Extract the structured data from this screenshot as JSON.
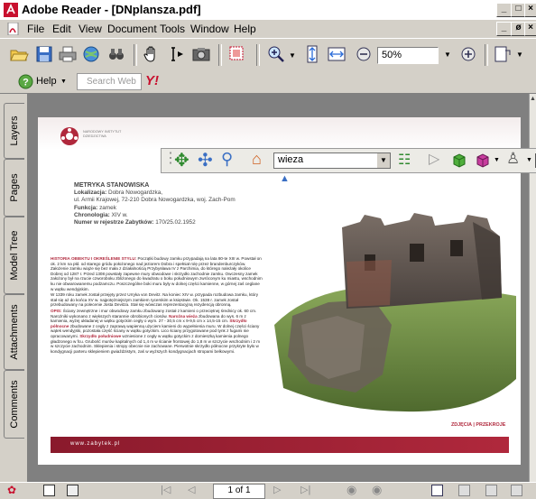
{
  "window": {
    "title": "Adobe Reader - [DNplansza.pdf]",
    "controls": [
      "_",
      "□",
      "×"
    ],
    "doc_controls": [
      "_",
      "ø",
      "×"
    ]
  },
  "menu": {
    "items": [
      "File",
      "Edit",
      "View",
      "Document",
      "Tools",
      "Window",
      "Help"
    ]
  },
  "toolbar": {
    "zoom_value": "50%",
    "search_placeholder": "Search Web",
    "help_label": "Help"
  },
  "model_toolbar": {
    "view_value": "wieza"
  },
  "side_tabs": [
    "Layers",
    "Pages",
    "Model Tree",
    "Attachments",
    "Comments"
  ],
  "document": {
    "heading": "METRYKA STANOWISKA",
    "lines": [
      {
        "label": "Lokalizacja:",
        "value": "Dobra Nowogardzka,"
      },
      {
        "label": "",
        "value": "ul. Armii Krajowej, 72-210 Dobra Nowogardzka, woj. Zach-Pom"
      },
      {
        "label": "Funkcja:",
        "value": "zamek"
      },
      {
        "label": "Chronologia:",
        "value": "XIV w."
      },
      {
        "label": "Numer w rejestrze Zabytków:",
        "value": "170/25.02.1952"
      }
    ],
    "logo_text": "NARODOWY INSTYTUT DZIEDZICTWA",
    "paragraph1_lead": "HISTORIA OBIEKTU I OKREŚLENIE STYLU:",
    "paragraph1": "Początki budowy zamku przypadają na lata 80-te XIII w. Powstał on ok. 2 km na płd. od starego gródu położonego nad jeziorem Dobra i spełniał rolę przez brandenburczyków. Założenie zamku wiąże się bez mała z działalnością Przybysława IV z Parchimia, do którego należały okolice Dobrej od 1287 r. Przed 1308 powstały zapewne mury obwodowe i skrzydło zachodnie zamku. Owczesny zamek założony był na rzucie czworoboku zbliżonego do kwadratu o boku południowym zwróconym ku miastu, wschodnim ku nie obwarowanemu podzamczu. Poszczególne boki muru były w dolnej części kamienne, w górnej zaś ceglane w wątku wendyjskim.",
    "paragraph2": "W 1339 roku zamek został przejęty przez Urryka von Devitz. Na koniec XIV w. przypada rozbudowa zamku, który stał się aż do końca XV w. najpotężniejszym zamkiem rycerskim w księstwie. Ok. 1538 r. zamek został przebudowany na polecenie Josta Devitza. Stał się wówczas reprezentacyjną rezydencją obronną.",
    "paragraph3_lead": "OPIS:",
    "paragraph3": "Ściany zewnętrzne i mur obwodowy zamku zbudowany został z kamieni o przeciętnej średnicy ok. 60 cm. Narożniki wykonano z większych starannie obrobionych ciosów.",
    "paragraph3_red": "Naroźna wieża",
    "paragraph3b": "zbudowana do wys. 6 m z kamienia, wyżej układanej w wątku gotyckim cegły o wym. 27 - 30,5 cm x 9-9,5 cm x 14,5-15 cm.",
    "paragraph3_red2": "Skrzydło północne",
    "paragraph3c": "zbudowane z cegły z zaprawą wapienną użyciem kamieni do wypełnienia muru. W dolnej części ściany wątek wendyjski, pozostała część ściany w wątku gotyckim. Lico ściany przygotowane pod tynk z fugami nie opracowanymi.",
    "paragraph3_red3": "Skrzydło południowe",
    "paragraph3d": "wzniesione z cegły w wątku gotyckim z domieszką kamienia polnego gładzonego w fcu. Grubość murów kapitalnych od 1,4 m w ścianie frontowej do 1,8 m w szczycie wschodnim i 2 m w szczycie zachodnim. Sklepienia i stropy obecnie nie zachowane. Pierwotnie skrzydło północne przykryte było w kondygnacji parteru sklepieniem gwiaździstym, zaś w wyższych kondygnacjach stropami belkowymi.",
    "footer_links": "ZDJĘCIA | PRZEKROJE",
    "footer_url": "www.zabytek.pl"
  },
  "status": {
    "page_indicator": "1 of 1"
  },
  "colors": {
    "accent_red": "#b0283c",
    "chrome": "#d4d0c8",
    "doc_bg": "#808080"
  }
}
